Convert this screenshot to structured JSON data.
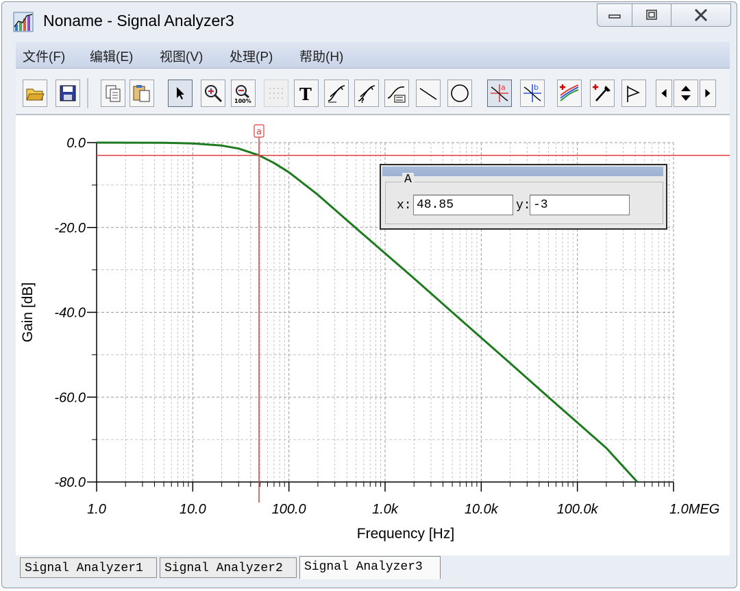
{
  "window": {
    "title": "Noname - Signal Analyzer3",
    "icon": "signal-analyzer-app-icon",
    "controls": [
      "minimize-icon",
      "maximize-icon",
      "close-icon"
    ]
  },
  "menu": [
    "文件(F)",
    "编辑(E)",
    "视图(V)",
    "处理(P)",
    "帮助(H)"
  ],
  "toolbar": [
    "open-folder-icon",
    "save-icon",
    "copy-icon",
    "paste-icon",
    "pointer-icon",
    "zoom-in-icon",
    "zoom-100-icon",
    "grid-icon",
    "text-icon",
    "label-icon",
    "label-query-icon",
    "legend-icon",
    "line-icon",
    "circle-icon",
    "cursor-a-icon",
    "cursor-b-icon",
    "add-curve-icon",
    "probe-icon",
    "flag-icon",
    "scroll-left-icon",
    "scroll-updown-icon",
    "scroll-right-icon"
  ],
  "readout": {
    "group_label": "A",
    "x_label": "x:",
    "x_value": "48.85",
    "y_label": "y:",
    "y_value": "-3"
  },
  "cursor": {
    "label": "a",
    "x": 48.85,
    "y": -3,
    "color": "#e03c3c"
  },
  "tabs": [
    "Signal Analyzer1",
    "Signal Analyzer2",
    "Signal Analyzer3"
  ],
  "active_tab": 2,
  "colors": {
    "curve": "#1e7a1e",
    "cursor": "#e03c3c",
    "grid": "#b4b4b4",
    "axis_text": "#000000"
  },
  "chart_data": {
    "type": "line",
    "title": "",
    "xlabel": "Frequency [Hz]",
    "ylabel": "Gain [dB]",
    "x_scale": "log",
    "xlim": [
      1,
      1000000
    ],
    "ylim": [
      -80,
      0
    ],
    "x_ticks": [
      1,
      10,
      100,
      1000,
      10000,
      100000,
      1000000
    ],
    "x_tick_labels": [
      "1.0",
      "10.0",
      "100.0",
      "1.0k",
      "10.0k",
      "100.0k",
      "1.0MEG"
    ],
    "y_ticks": [
      0,
      -20,
      -40,
      -60,
      -80
    ],
    "y_tick_labels": [
      "0.0",
      "-20.0",
      "-40.0",
      "-60.0",
      "-80.0"
    ],
    "grid": true,
    "series": [
      {
        "color": "#1e7a1e",
        "x": [
          1,
          5,
          10,
          20,
          30,
          48.85,
          70,
          100,
          200,
          500,
          1000,
          2000,
          5000,
          10000,
          20000,
          50000,
          100000,
          200000,
          420000
        ],
        "y": [
          0,
          -0.04,
          -0.2,
          -0.7,
          -1.4,
          -3,
          -4.8,
          -7.0,
          -12.3,
          -20.2,
          -26.1,
          -32.0,
          -40.0,
          -46.0,
          -52.0,
          -60.0,
          -66.0,
          -72.0,
          -80.0
        ]
      }
    ]
  }
}
